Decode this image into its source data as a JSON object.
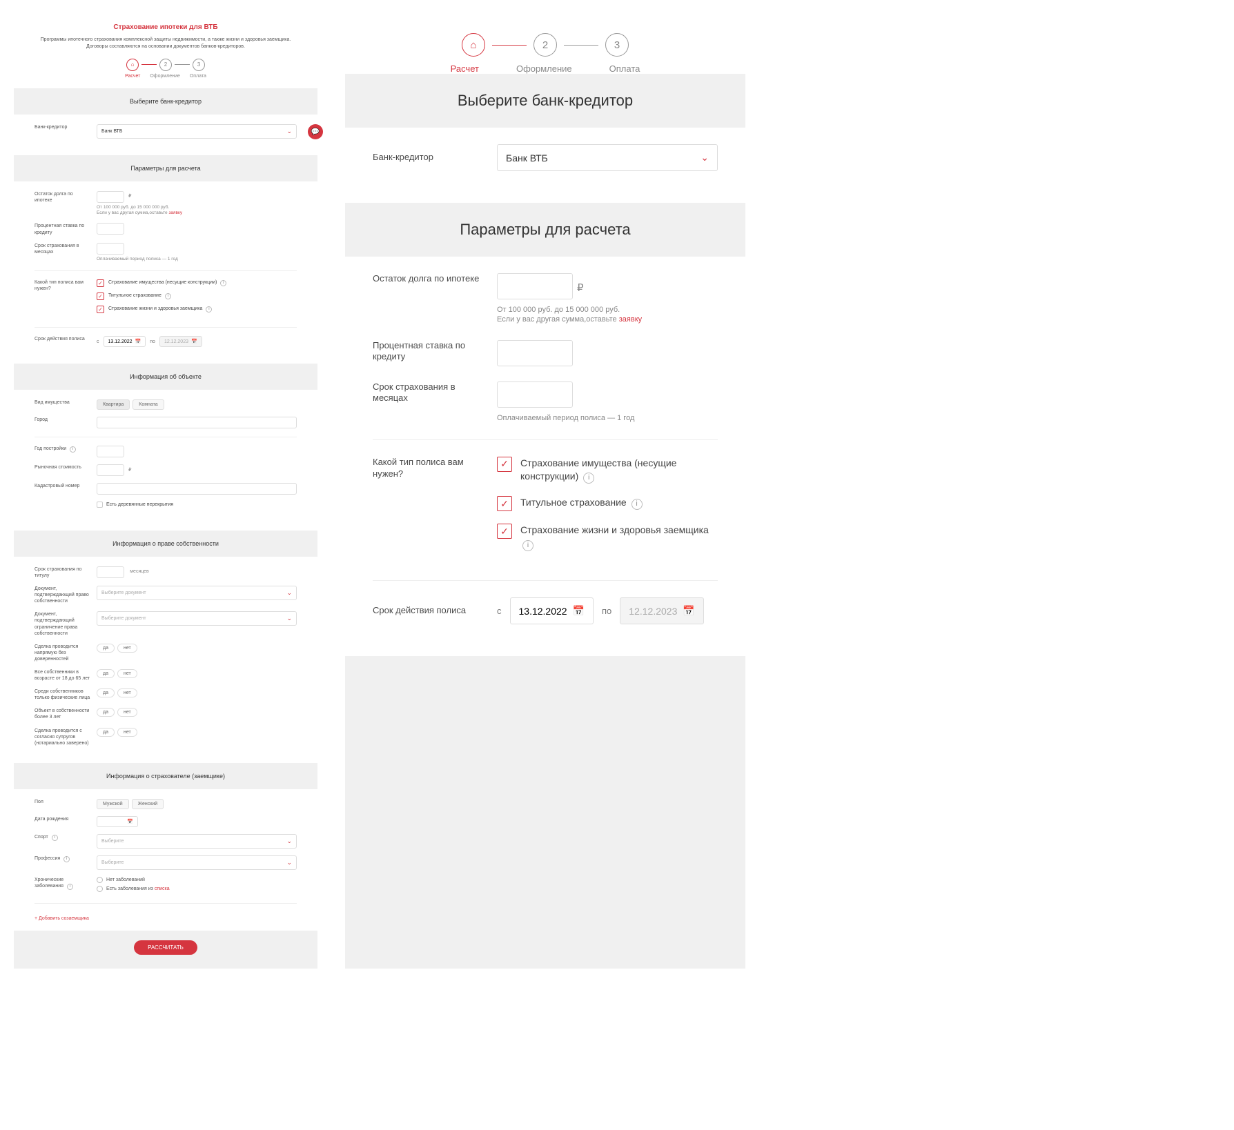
{
  "header": {
    "title": "Страхование ипотеки для ВТБ",
    "lead": "Программы ипотечного страхования комплексной защиты недвижимости, а также жизни и здоровья заемщика. Договоры составляются на основании документов банков-кредиторов."
  },
  "steps": {
    "s1": "Расчет",
    "s2": "Оформление",
    "s3": "Оплата"
  },
  "bank": {
    "heading": "Выберите банк-кредитор",
    "label": "Банк-кредитор",
    "value": "Банк ВТБ"
  },
  "params": {
    "heading": "Параметры для расчета",
    "balance_label": "Остаток долга по ипотеке",
    "currency": "₽",
    "hint1": "От 100 000 руб. до 15 000 000 руб.",
    "hint2a": "Если у вас другая сумма,оставьте ",
    "hint2b": "заявку",
    "rate_label": "Процентная ставка по кредиту",
    "term_label": "Срок страхования в месяцах",
    "pay_hint": "Оплачиваемый период полиса — 1 год",
    "policy_type_label": "Какой тип полиса вам нужен?",
    "c1": "Страхование имущества (несущие конструкции)",
    "c2": "Титульное страхование",
    "c3": "Страхование жизни и здоровья заемщика",
    "validity_label": "Срок действия полиса",
    "from": "с",
    "to": "по",
    "date1": "13.12.2022",
    "date2": "12.12.2023"
  },
  "object": {
    "heading": "Информация об объекте",
    "prop_type": "Вид имущества",
    "opt1": "Квартира",
    "opt2": "Комната",
    "city": "Город",
    "year": "Год постройки",
    "market": "Рыночная стоимость",
    "cadastral": "Кадастровый номер",
    "wood": "Есть деревянные перекрытия"
  },
  "ownership": {
    "heading": "Информация о праве собственности",
    "title_term": "Срок страхования по титулу",
    "months": "месяцев",
    "doc1": "Документ, подтверждающий право собственности",
    "doc2": "Документ, подтверждающий ограничение права собственности",
    "placeholder": "Выберите документ",
    "q1": "Сделка проводится напрямую без доверенностей",
    "q2": "Все собственники в возрасте от 18 до 65 лет",
    "q3": "Среди собственников только физические лица",
    "q4": "Объект в собственности более 3 лет",
    "q5": "Сделка проводится с согласия супругов (нотариально заверено)",
    "yes": "да",
    "no": "нет"
  },
  "insured": {
    "heading": "Информация о страхователе (заемщике)",
    "gender": "Пол",
    "male": "Мужской",
    "female": "Женский",
    "dob": "Дата рождения",
    "sport": "Спорт",
    "profession": "Профессия",
    "select_ph": "Выберите",
    "chronic": "Хронические заболевания",
    "chronic_no": "Нет заболеваний",
    "chronic_yes_a": "Есть заболевания из ",
    "chronic_yes_b": "списка",
    "add": "+ Добавить созаемщика"
  },
  "calc": "РАССЧИТАТЬ"
}
